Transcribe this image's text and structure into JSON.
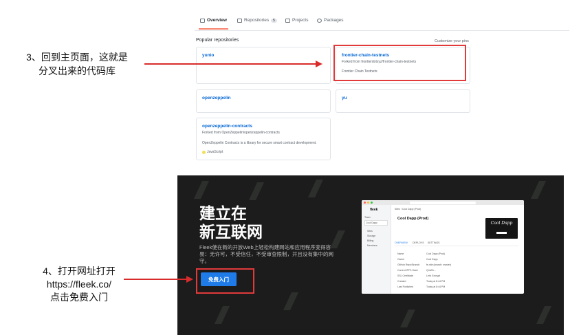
{
  "github": {
    "tabs": [
      {
        "label": "Overview"
      },
      {
        "label": "Repositories",
        "count": "5"
      },
      {
        "label": "Projects"
      },
      {
        "label": "Packages"
      }
    ],
    "popular_title": "Popular repositories",
    "customize_link": "Customize your pins",
    "repos": [
      {
        "name": "yunio"
      },
      {
        "name": "frontier-chain-testnets",
        "forked_from": "Forked from frontierdotxyz/frontier-chain-testnets",
        "description": "Frontier Chain Testnets"
      },
      {
        "name": "openzeppelin"
      },
      {
        "name": "yu"
      },
      {
        "name": "openzeppelin-contracts",
        "forked_from": "Forked from OpenZeppelin/openzeppelin-contracts",
        "description": "OpenZeppelin Contracts is a library for secure smart contract development.",
        "language": "JavaScript"
      }
    ]
  },
  "annotations": {
    "step3_line1": "3、回到主页面，这就是",
    "step3_line2": "分叉出来的代码库",
    "step4_line1": "4、打开网址打开",
    "step4_line2": "https://fleek.co/",
    "step4_line3": "点击免费入门"
  },
  "fleek": {
    "headline_line1": "建立在",
    "headline_line2": "新互联网",
    "description": "Fleek使在新的开放Web上轻松构建网站和应用程序变得容易：无许可，不受信任，不受审查限制，并且没有集中的网守。",
    "cta_label": "免费入门",
    "window": {
      "brand": "fleek",
      "breadcrumb": "Sites › Cool Dapp (Prod)",
      "site_title": "Cool Dapp (Prod)",
      "team_label": "Team",
      "team_value": "Cool Dapp",
      "nav": [
        "Sites",
        "Storage",
        "Billing",
        "Members"
      ],
      "tabs": [
        "OVERVIEW",
        "DEPLOYS",
        "SETTINGS"
      ],
      "thumb_title": "Cool Dapp",
      "details": [
        {
          "key": "Name",
          "value": "Cool Dapp (Prod)"
        },
        {
          "key": "Owner",
          "value": "Cool Dapp"
        },
        {
          "key": "GitHub Repo/Branch",
          "value": "fe-site (branch: master)"
        },
        {
          "key": "Current IPFS Hash",
          "value": "QmWh..."
        },
        {
          "key": "SSL Certificate",
          "value": "Let's Encrypt"
        },
        {
          "key": "Created",
          "value": "Today at 8:44 PM"
        },
        {
          "key": "Last Published",
          "value": "Today at 8:44 PM"
        }
      ]
    }
  }
}
